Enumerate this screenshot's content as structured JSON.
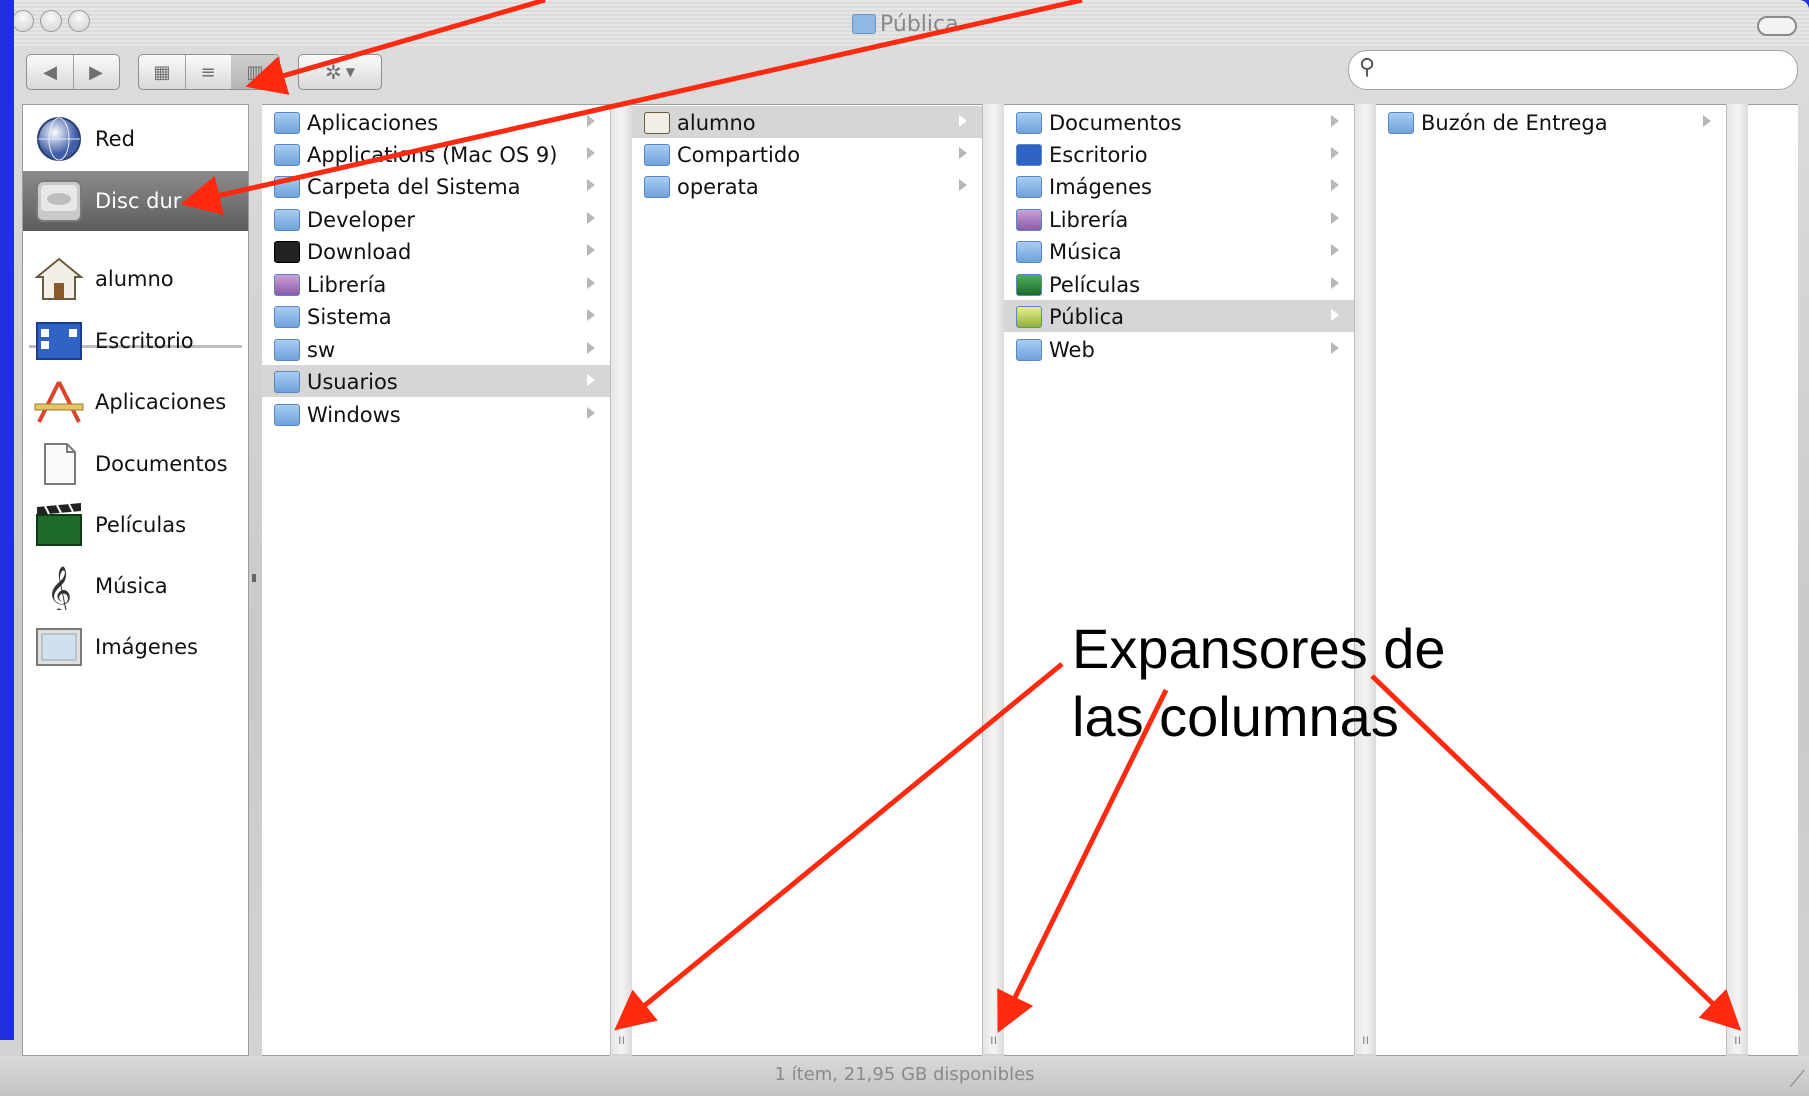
{
  "window": {
    "title": "Pública",
    "status": "1 ítem, 21,95 GB disponibles"
  },
  "toolbar": {
    "back_icon": "back-arrow-icon",
    "forward_icon": "forward-arrow-icon",
    "view_buttons": [
      "icon-view",
      "list-view",
      "column-view"
    ],
    "action_icon": "gear-icon",
    "search": {
      "value": "",
      "placeholder": ""
    }
  },
  "sidebar": {
    "devices": [
      {
        "label": "Red",
        "icon": "network-globe-icon"
      },
      {
        "label": "Disc dur",
        "icon": "hard-disk-icon",
        "selected": true
      }
    ],
    "places": [
      {
        "label": "alumno",
        "icon": "home-icon"
      },
      {
        "label": "Escritorio",
        "icon": "desktop-icon"
      },
      {
        "label": "Aplicaciones",
        "icon": "applications-icon"
      },
      {
        "label": "Documentos",
        "icon": "document-icon"
      },
      {
        "label": "Películas",
        "icon": "clapperboard-icon"
      },
      {
        "label": "Música",
        "icon": "treble-clef-icon"
      },
      {
        "label": "Imágenes",
        "icon": "picture-frame-icon"
      }
    ]
  },
  "columns": [
    {
      "items": [
        {
          "label": "Aplicaciones"
        },
        {
          "label": "Applications (Mac OS 9)"
        },
        {
          "label": "Carpeta del Sistema"
        },
        {
          "label": "Developer"
        },
        {
          "label": "Download"
        },
        {
          "label": "Librería"
        },
        {
          "label": "Sistema"
        },
        {
          "label": "sw"
        },
        {
          "label": "Usuarios",
          "selected": true
        },
        {
          "label": "Windows"
        }
      ]
    },
    {
      "items": [
        {
          "label": "alumno",
          "selected": true
        },
        {
          "label": "Compartido"
        },
        {
          "label": "operata"
        }
      ]
    },
    {
      "items": [
        {
          "label": "Documentos"
        },
        {
          "label": "Escritorio"
        },
        {
          "label": "Imágenes"
        },
        {
          "label": "Librería"
        },
        {
          "label": "Música"
        },
        {
          "label": "Películas"
        },
        {
          "label": "Pública",
          "selected": true
        },
        {
          "label": "Web"
        }
      ]
    },
    {
      "items": [
        {
          "label": "Buzón de Entrega"
        }
      ]
    }
  ],
  "annotation": {
    "line1": "Expansores de",
    "line2": "las columnas",
    "arrow_color": "#ff2a10"
  }
}
